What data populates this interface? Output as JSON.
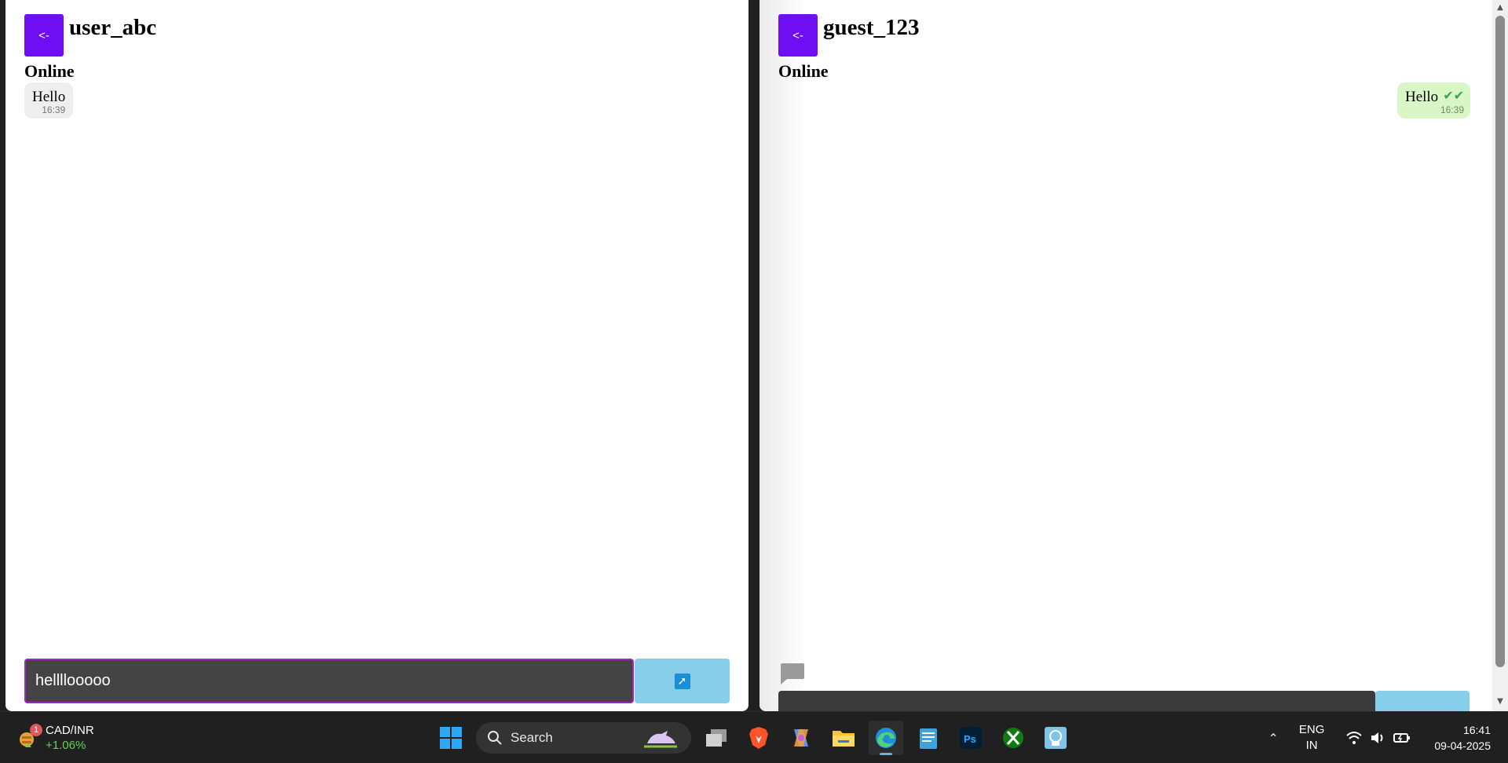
{
  "left_chat": {
    "back_label": "<-",
    "name": "user_abc",
    "status": "Online",
    "messages": [
      {
        "text": "Hello",
        "time": "16:39"
      }
    ],
    "input_value": "hellllooooo"
  },
  "right_chat": {
    "back_label": "<-",
    "name": "guest_123",
    "status": "Online",
    "messages": [
      {
        "text": "Hello",
        "time": "16:39",
        "read": true
      }
    ]
  },
  "taskbar": {
    "widget": {
      "pair": "CAD/INR",
      "change": "+1.06%",
      "badge": "1"
    },
    "search_label": "Search",
    "apps": [
      "task-view",
      "brave",
      "copilot",
      "file-explorer",
      "edge",
      "notepad",
      "photoshop",
      "xbox",
      "remote-app"
    ],
    "active_app": "edge",
    "lang_line1": "ENG",
    "lang_line2": "IN",
    "time": "16:41",
    "date": "09-04-2025"
  },
  "colors": {
    "back_button": "#6f0df3",
    "send_button": "#87ceeb",
    "sent_bubble": "#d9f7c6",
    "received_bubble": "#eeeeee",
    "input_bg": "#444444",
    "input_border": "#9b2ac3"
  }
}
